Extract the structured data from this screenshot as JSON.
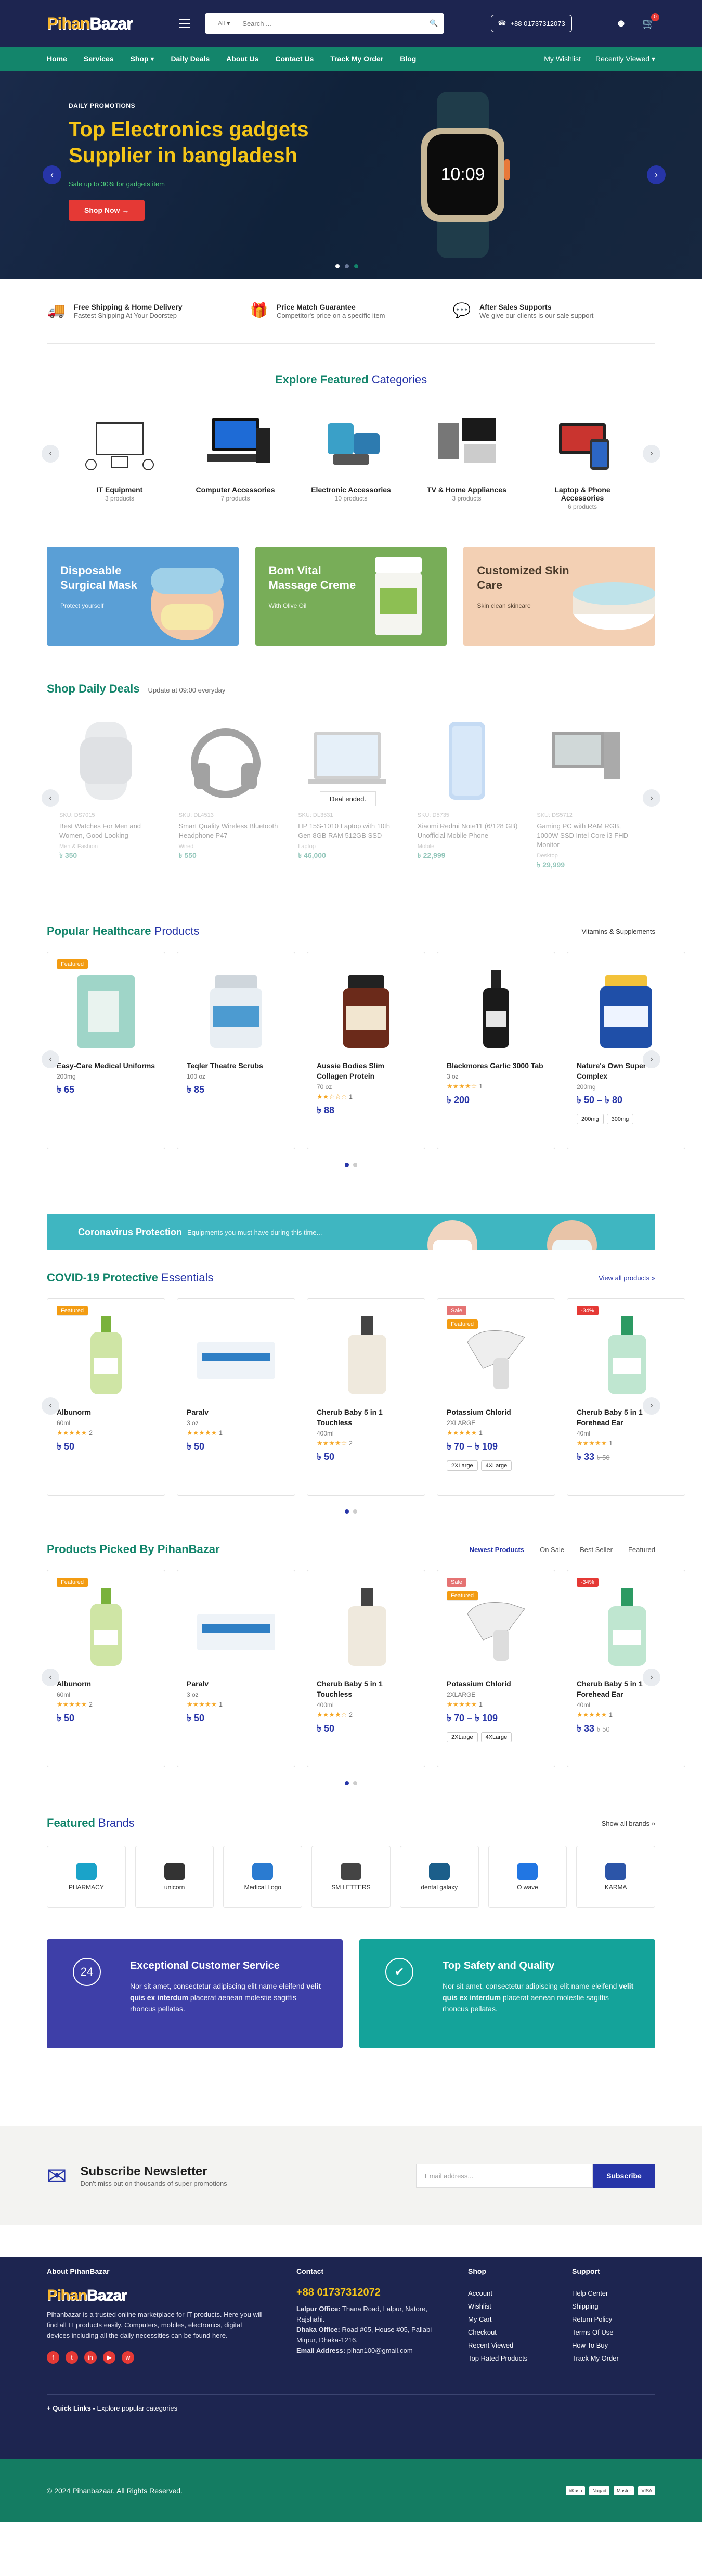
{
  "header": {
    "logo_a": "Pihan",
    "logo_b": "Bazar",
    "search_cat": "All",
    "search_placeholder": "Search ...",
    "phone": "+88 01737312073",
    "cart_count": "0"
  },
  "nav": {
    "left": [
      "Home",
      "Services",
      "Shop ▾",
      "Daily Deals",
      "About Us",
      "Contact Us",
      "Track My Order",
      "Blog"
    ],
    "right": [
      "My Wishlist",
      "Recently Viewed ▾"
    ]
  },
  "hero": {
    "tag": "DAILY PROMOTIONS",
    "title": "Top Electronics gadgets Supplier in bangladesh",
    "sub": "Sale up to 30% for gadgets item",
    "button": "Shop Now",
    "watch_time": "10:09"
  },
  "features": [
    {
      "title": "Free Shipping & Home Delivery",
      "sub": "Fastest Shipping At Your Doorstep",
      "icon": "truck-icon"
    },
    {
      "title": "Price Match Guarantee",
      "sub": "Competitor's price on a specific item",
      "icon": "gift-icon"
    },
    {
      "title": "After Sales Supports",
      "sub": "We give our clients is our sale support",
      "icon": "support-icon"
    }
  ],
  "categories": {
    "title_a": "Explore Featured",
    "title_b": "Categories",
    "items": [
      {
        "name": "IT Equipment",
        "count": "3 products"
      },
      {
        "name": "Computer Accessories",
        "count": "7 products"
      },
      {
        "name": "Electronic Accessories",
        "count": "10 products"
      },
      {
        "name": "TV & Home Appliances",
        "count": "3 products"
      },
      {
        "name": "Laptop & Phone Accessories",
        "count": "6 products"
      }
    ]
  },
  "promos": [
    {
      "title": "Disposable Surgical Mask",
      "sub": "Protect yourself",
      "color": "#5a9fd6"
    },
    {
      "title": "Bom Vital Massage Creme",
      "sub": "With Olive Oil",
      "color": "#78ad58"
    },
    {
      "title": "Customized Skin Care",
      "sub": "Skin clean skincare",
      "color": "#f3d0b4"
    }
  ],
  "deals": {
    "title": "Shop Daily Deals",
    "sub": "Update at 09:00 everyday",
    "ended": "Deal ended.",
    "items": [
      {
        "meta": "SKU: DS7015",
        "name": "Best Watches For Men and Women, Good Looking",
        "unit": "Men & Fashion",
        "price": "৳ 350"
      },
      {
        "meta": "SKU: DL4513",
        "name": "Smart Quality Wireless Bluetooth Headphone P47",
        "unit": "Wired",
        "price": "৳ 550"
      },
      {
        "meta": "SKU: DL3531",
        "name": "HP 15S-1010 Laptop with 10th Gen 8GB RAM 512GB SSD",
        "unit": "Laptop",
        "price": "৳ 46,000"
      },
      {
        "meta": "SKU: D5735",
        "name": "Xiaomi Redmi Note11 (6/128 GB) Unofficial Mobile Phone",
        "unit": "Mobile",
        "price": "৳ 22,999"
      },
      {
        "meta": "SKU: DS5712",
        "name": "Gaming PC with RAM RGB, 1000W SSD Intel Core i3 FHD Monitor",
        "unit": "Desktop",
        "price": "৳ 29,999"
      }
    ]
  },
  "healthcare": {
    "title_a": "Popular Healthcare",
    "title_b": "Products",
    "link": "Vitamins & Supplements",
    "items": [
      {
        "label": "Featured",
        "name": "Easy-Care Medical Uniforms",
        "unit": "200mg",
        "stars": "",
        "price": "৳ 65",
        "opts": []
      },
      {
        "label": "",
        "name": "Teqler Theatre Scrubs",
        "unit": "100 oz",
        "stars": "",
        "price": "৳ 85",
        "opts": []
      },
      {
        "label": "",
        "name": "Aussie Bodies Slim Collagen Protein",
        "unit": "70 oz",
        "stars": "★★☆☆☆",
        "rating": "1",
        "price": "৳ 88",
        "opts": []
      },
      {
        "label": "",
        "name": "Blackmores Garlic 3000 Tab",
        "unit": "3 oz",
        "stars": "★★★★☆",
        "rating": "1",
        "price": "৳ 200",
        "opts": []
      },
      {
        "label": "",
        "name": "Nature's Own Super B Complex",
        "unit": "200mg",
        "stars": "",
        "price": "৳ 50 – ৳ 80",
        "opts": [
          "200mg",
          "300mg"
        ]
      }
    ]
  },
  "covid_banner": {
    "title": "Coronavirus Protection",
    "sub": "Equipments you must have during this time..."
  },
  "covid": {
    "title_a": "COVID-19 Protective",
    "title_b": "Essentials",
    "link": "View all products »",
    "items": [
      {
        "label": "Featured",
        "label2": "",
        "name": "Albunorm",
        "unit": "60ml",
        "stars": "★★★★★",
        "rating": "2",
        "price": "৳ 50",
        "old": "",
        "opts": []
      },
      {
        "label": "",
        "label2": "",
        "name": "Paralv",
        "unit": "3 oz",
        "stars": "★★★★★",
        "rating": "1",
        "price": "৳ 50",
        "old": "",
        "opts": []
      },
      {
        "label": "",
        "label2": "",
        "name": "Cherub Baby 5 in 1 Touchless",
        "unit": "400ml",
        "stars": "★★★★☆",
        "rating": "2",
        "price": "৳ 50",
        "old": "",
        "opts": []
      },
      {
        "label": "Sale",
        "label2": "Featured",
        "name": "Potassium Chlorid",
        "unit": "2XLARGE",
        "stars": "★★★★★",
        "rating": "1",
        "price": "৳ 70 – ৳ 109",
        "old": "",
        "opts": [
          "2XLarge",
          "4XLarge"
        ]
      },
      {
        "label": "-34%",
        "label2": "",
        "name": "Cherub Baby 5 in 1 Forehead Ear",
        "unit": "40ml",
        "stars": "★★★★★",
        "rating": "1",
        "price": "৳ 33",
        "old": "৳ 50",
        "opts": []
      }
    ]
  },
  "picked": {
    "title": "Products Picked By PihanBazar",
    "tabs": [
      "Newest Products",
      "On Sale",
      "Best Seller",
      "Featured"
    ],
    "items": [
      {
        "label": "Featured",
        "label2": "",
        "name": "Albunorm",
        "unit": "60ml",
        "stars": "★★★★★",
        "rating": "2",
        "price": "৳ 50",
        "old": "",
        "opts": []
      },
      {
        "label": "",
        "label2": "",
        "name": "Paralv",
        "unit": "3 oz",
        "stars": "★★★★★",
        "rating": "1",
        "price": "৳ 50",
        "old": "",
        "opts": []
      },
      {
        "label": "",
        "label2": "",
        "name": "Cherub Baby 5 in 1 Touchless",
        "unit": "400ml",
        "stars": "★★★★☆",
        "rating": "2",
        "price": "৳ 50",
        "old": "",
        "opts": []
      },
      {
        "label": "Sale",
        "label2": "Featured",
        "name": "Potassium Chlorid",
        "unit": "2XLARGE",
        "stars": "★★★★★",
        "rating": "1",
        "price": "৳ 70 – ৳ 109",
        "old": "",
        "opts": [
          "2XLarge",
          "4XLarge"
        ]
      },
      {
        "label": "-34%",
        "label2": "",
        "name": "Cherub Baby 5 in 1 Forehead Ear",
        "unit": "40ml",
        "stars": "★★★★★",
        "rating": "1",
        "price": "৳ 33",
        "old": "৳ 50",
        "opts": []
      }
    ]
  },
  "brands": {
    "title_a": "Featured",
    "title_b": "Brands",
    "link": "Show all brands »",
    "items": [
      "PHARMACY",
      "unicorn",
      "Medical Logo",
      "SM LETTERS",
      "dental galaxy",
      "O wave",
      "KARMA"
    ]
  },
  "services": [
    {
      "title": "Exceptional Customer Service",
      "text_a": "Nor sit amet, consectetur adipiscing elit name eleifend ",
      "text_b": "velit quis ex interdum",
      "text_c": " placerat aenean molestie sagittis rhoncus pellatas.",
      "color": "#3e3fa8"
    },
    {
      "title": "Top Safety and Quality",
      "text_a": "Nor sit amet, consectetur adipiscing elit name eleifend ",
      "text_b": "velit quis ex interdum",
      "text_c": " placerat aenean molestie sagittis rhoncus pellatas.",
      "color": "#14a39a"
    }
  ],
  "newsletter": {
    "title": "Subscribe Newsletter",
    "sub": "Don't miss out on thousands of super promotions",
    "placeholder": "Email address...",
    "button": "Subscribe"
  },
  "footer": {
    "about_title": "About PihanBazar",
    "about": "Pihanbazar is a trusted online marketplace for IT products. Here you will find all IT products easily. Computers, mobiles, electronics, digital devices including all the daily necessities can be found here.",
    "contact_title": "Contact",
    "phone": "+88 01737312072",
    "lalpur_lbl": "Lalpur Office:",
    "lalpur": " Thana Road, Lalpur, Natore, Rajshahi.",
    "dhaka_lbl": "Dhaka Office:",
    "dhaka": " Road #05, House #05, Pallabi Mirpur, Dhaka-1216.",
    "email_lbl": "Email Address:",
    "email": " pihan100@gmail.com",
    "shop_title": "Shop",
    "shop": [
      "Account",
      "Wishlist",
      "My Cart",
      "Checkout",
      "Recent Viewed",
      "Top Rated Products"
    ],
    "support_title": "Support",
    "support": [
      "Help Center",
      "Shipping",
      "Return Policy",
      "Terms Of Use",
      "How To Buy",
      "Track My Order"
    ],
    "quick_lbl": "+ Quick Links -",
    "quick": " Explore popular categories",
    "copyright": "© 2024 Pihanbazaar. All Rights Reserved.",
    "payments": [
      "bKash",
      "Nagad",
      "Master",
      "VISA"
    ]
  }
}
